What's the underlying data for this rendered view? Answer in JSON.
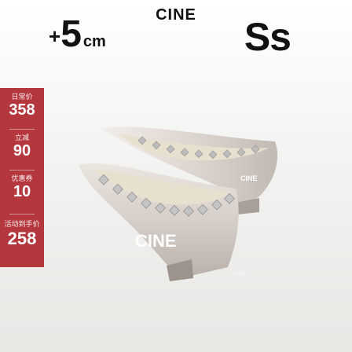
{
  "brand": {
    "top_logo": "CINE",
    "shoe_logo_front": "CINE",
    "shoe_logo_back": "CINE",
    "shoe_logo_small": "CINE"
  },
  "badges": {
    "height_plus": "+",
    "height_value": "5",
    "height_unit": "cm",
    "size_code": "Ss"
  },
  "prices": [
    {
      "label": "日常价",
      "value": "358"
    },
    {
      "label": "立减",
      "value": "90"
    },
    {
      "label": "优惠券",
      "value": "10"
    },
    {
      "label": "活动到手价",
      "value": "258"
    }
  ],
  "colors": {
    "price_panel": "#b5373e",
    "shoe_patent": "#d6cec8",
    "studs": "#bdbdbd",
    "insole": "#e8e0cf"
  }
}
